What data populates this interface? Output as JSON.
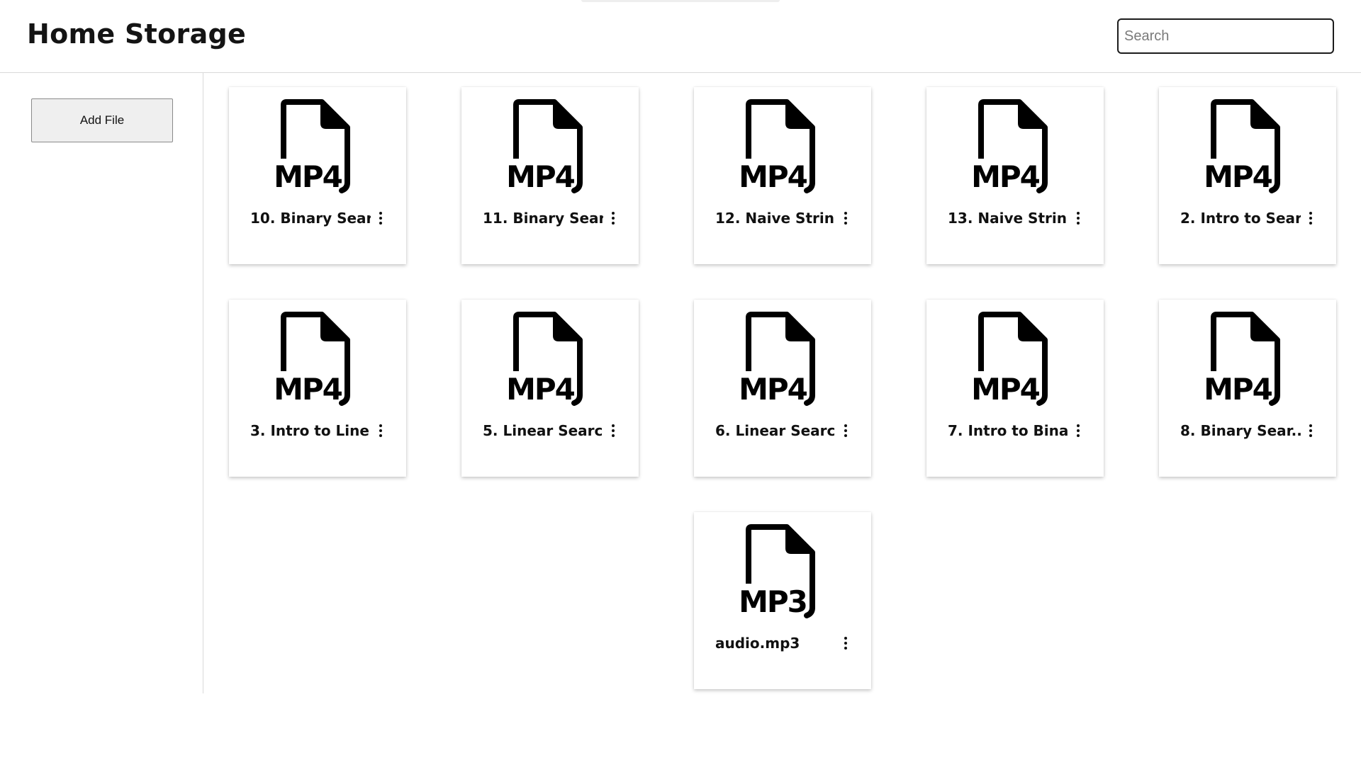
{
  "header": {
    "title": "Home Storage",
    "search_placeholder": "Search",
    "search_value": ""
  },
  "sidebar": {
    "add_file_label": "Add File"
  },
  "files": [
    {
      "name": "10. Binary Sear...",
      "type": "MP4"
    },
    {
      "name": "11. Binary Sear...",
      "type": "MP4"
    },
    {
      "name": "12. Naive Strin...",
      "type": "MP4"
    },
    {
      "name": "13. Naive Strin...",
      "type": "MP4"
    },
    {
      "name": "2. Intro to Sear...",
      "type": "MP4"
    },
    {
      "name": "3. Intro to Line...",
      "type": "MP4"
    },
    {
      "name": "5. Linear Searc...",
      "type": "MP4"
    },
    {
      "name": "6. Linear Searc...",
      "type": "MP4"
    },
    {
      "name": "7. Intro to Bina...",
      "type": "MP4"
    },
    {
      "name": "8. Binary Sear...",
      "type": "MP4"
    },
    {
      "name": "audio.mp3",
      "type": "MP3"
    }
  ],
  "icons": {
    "file": "file-icon",
    "more": "more-vertical-icon"
  }
}
